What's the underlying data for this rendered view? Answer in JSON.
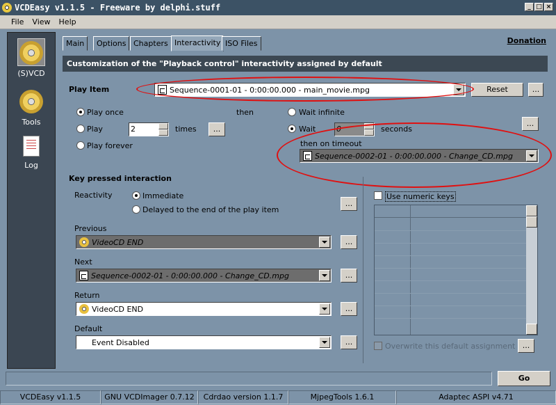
{
  "window": {
    "title": "VCDEasy v1.1.5 - Freeware by delphi.stuff",
    "min": "_",
    "max": "□",
    "close": "×"
  },
  "menu": [
    {
      "label": "File"
    },
    {
      "label": "View"
    },
    {
      "label": "Help"
    }
  ],
  "sidebar": {
    "items": [
      {
        "label": "(S)VCD",
        "icon": "svcd-disc-icon"
      },
      {
        "label": "Tools",
        "icon": "tools-disc-icon"
      },
      {
        "label": "Log",
        "icon": "log-document-icon"
      }
    ],
    "svcd_icon_text": "SVCD"
  },
  "tabs": [
    {
      "label": "Main"
    },
    {
      "label": "Options"
    },
    {
      "label": "Chapters"
    },
    {
      "label": "Interactivity",
      "active": true
    },
    {
      "label": "ISO Files"
    }
  ],
  "donation": "Donation",
  "header": "Customization of the \"Playback control\" interactivity assigned by default",
  "play_item": {
    "label": "Play Item",
    "value": "Sequence-0001-01 - 0:00:00.000 - main_movie.mpg",
    "reset": "Reset",
    "more": "..."
  },
  "play_mode": {
    "once": "Play once",
    "play": "Play",
    "times_value": "2",
    "times": "times",
    "forever": "Play forever",
    "more": "..."
  },
  "then": "then",
  "wait": {
    "infinite": "Wait infinite",
    "wait": "Wait",
    "seconds_value": "0",
    "seconds": "seconds",
    "more": "...",
    "then_on_timeout": "then on timeout",
    "timeout_value": "Sequence-0002-01 - 0:00:00.000 - Change_CD.mpg"
  },
  "key_pressed": {
    "title": "Key pressed interaction",
    "reactivity": "Reactivity",
    "immediate": "Immediate",
    "delayed": "Delayed to the end of the play item",
    "more": "...",
    "previous_label": "Previous",
    "previous_value": "VideoCD END",
    "next_label": "Next",
    "next_value": "Sequence-0002-01 - 0:00:00.000 - Change_CD.mpg",
    "return_label": "Return",
    "return_value": "VideoCD END",
    "default_label": "Default",
    "default_value": "Event Disabled"
  },
  "numeric": {
    "use_numeric": "Use numeric keys",
    "overwrite": "Overwrite this default assignment",
    "more": "..."
  },
  "go": "Go",
  "status": [
    "VCDEasy v1.1.5",
    "GNU VCDImager 0.7.12",
    "Cdrdao version 1.1.7",
    "MjpegTools 1.6.1",
    "Adaptec ASPI v4.71"
  ],
  "colors": {
    "accent_annotation": "#e01010",
    "header_bg": "#3c4853",
    "panel_bg": "#7d93a8"
  }
}
